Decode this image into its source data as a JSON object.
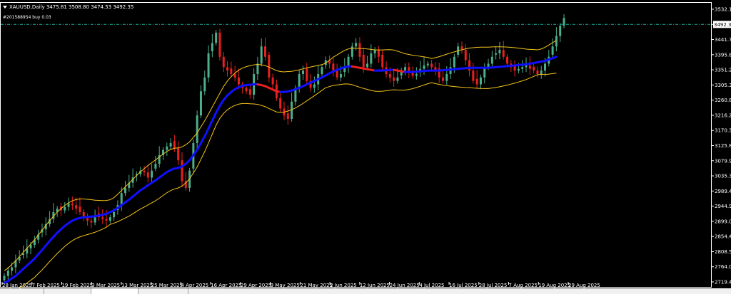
{
  "window": {
    "header": "XAUUSD,Daily  3475.81 3508.80 3474.53 3492.35",
    "order_label": "#201588954 buy 0.03"
  },
  "colors": {
    "background": "#000000",
    "frame": "#ffffff",
    "bull_candle": "#4caf8a",
    "bear_candle": "#e8201e",
    "fast_ma": "#1010ff",
    "ma_down_segment": "#e8201e",
    "envelope": "#f5c518",
    "order_line": "#1ab0a0",
    "price_box_bg": "#ffffff",
    "price_box_fg": "#000000"
  },
  "icons": {
    "menu_icon": "triangle-down-icon"
  },
  "chart_data": {
    "type": "candlestick",
    "symbol": "XAUUSD",
    "timeframe": "Daily",
    "last": {
      "open": 3475.81,
      "high": 3508.8,
      "low": 3474.53,
      "close": 3492.35
    },
    "current_price_label": "3492.35",
    "order_price": 3492.35,
    "y_ticks": [
      "3532.15",
      "3492.35",
      "3441.70",
      "3395.80",
      "3351.25",
      "3305.35",
      "3260.80",
      "3216.25",
      "3170.35",
      "3125.80",
      "3079.90",
      "3035.35",
      "2989.45",
      "2944.90",
      "2899.00",
      "2854.45",
      "2808.55",
      "2764.00",
      "2719.45"
    ],
    "ylim": [
      2719.45,
      3532.15
    ],
    "x_ticks": [
      "28 Jan 2025",
      "7 Feb 2025",
      "19 Feb 2025",
      "3 Mar 2025",
      "13 Mar 2025",
      "25 Mar 2025",
      "4 Apr 2025",
      "16 Apr 2025",
      "29 Apr 2025",
      "9 May 2025",
      "21 May 2025",
      "2 Jun 2025",
      "12 Jun 2025",
      "24 Jun 2025",
      "4 Jul 2025",
      "16 Jul 2025",
      "28 Jul 2025",
      "7 Aug 2025",
      "19 Aug 2025",
      "29 Aug 2025"
    ],
    "series_close": [
      2745,
      2760,
      2770,
      2790,
      2800,
      2810,
      2825,
      2835,
      2850,
      2865,
      2880,
      2895,
      2910,
      2930,
      2940,
      2935,
      2945,
      2955,
      2950,
      2940,
      2930,
      2915,
      2905,
      2900,
      2920,
      2915,
      2910,
      2905,
      2915,
      2930,
      2950,
      2985,
      3000,
      3015,
      3030,
      3040,
      3050,
      3045,
      3030,
      3050,
      3070,
      3095,
      3110,
      3120,
      3130,
      3115,
      3080,
      3020,
      3000,
      3050,
      3130,
      3210,
      3280,
      3320,
      3390,
      3420,
      3450,
      3380,
      3350,
      3340,
      3330,
      3320,
      3300,
      3290,
      3280,
      3270,
      3330,
      3360,
      3410,
      3380,
      3320,
      3300,
      3260,
      3230,
      3210,
      3200,
      3250,
      3290,
      3330,
      3340,
      3310,
      3290,
      3300,
      3330,
      3350,
      3370,
      3360,
      3340,
      3320,
      3330,
      3350,
      3380,
      3410,
      3420,
      3380,
      3350,
      3360,
      3390,
      3400,
      3380,
      3350,
      3330,
      3320,
      3310,
      3320,
      3340,
      3350,
      3335,
      3325,
      3330,
      3345,
      3355,
      3360,
      3350,
      3340,
      3320,
      3310,
      3330,
      3350,
      3380,
      3410,
      3400,
      3370,
      3340,
      3310,
      3300,
      3320,
      3350,
      3360,
      3380,
      3390,
      3400,
      3380,
      3360,
      3350,
      3340,
      3345,
      3350,
      3355,
      3345,
      3340,
      3330,
      3340,
      3360,
      3380,
      3410,
      3440,
      3470,
      3492.35
    ],
    "series_fast_ma": [
      2725,
      2730,
      2738,
      2745,
      2755,
      2765,
      2775,
      2785,
      2795,
      2808,
      2820,
      2833,
      2846,
      2858,
      2870,
      2880,
      2890,
      2898,
      2905,
      2910,
      2913,
      2915,
      2916,
      2917,
      2918,
      2920,
      2922,
      2925,
      2930,
      2935,
      2942,
      2950,
      2958,
      2966,
      2975,
      2984,
      2993,
      3000,
      3008,
      3015,
      3022,
      3030,
      3038,
      3046,
      3052,
      3056,
      3058,
      3062,
      3070,
      3080,
      3095,
      3110,
      3130,
      3150,
      3172,
      3195,
      3218,
      3238,
      3255,
      3268,
      3278,
      3286,
      3292,
      3296,
      3298,
      3299,
      3300,
      3300,
      3298,
      3295,
      3290,
      3285,
      3280,
      3278,
      3278,
      3280,
      3282,
      3286,
      3290,
      3295,
      3300,
      3305,
      3310,
      3315,
      3320,
      3326,
      3332,
      3338,
      3342,
      3346,
      3350,
      3352,
      3352,
      3350,
      3348,
      3346,
      3344,
      3342,
      3340,
      3340,
      3340,
      3341,
      3342,
      3342,
      3340,
      3338,
      3336,
      3336,
      3336,
      3337,
      3338,
      3339,
      3340,
      3340,
      3340,
      3340,
      3341,
      3342,
      3343,
      3344,
      3345,
      3346,
      3347,
      3348,
      3348,
      3348,
      3348,
      3348,
      3348,
      3349,
      3350,
      3351,
      3352,
      3353,
      3354,
      3355,
      3356,
      3357,
      3358,
      3360,
      3362,
      3364,
      3366,
      3368,
      3372,
      3376,
      3380
    ]
  },
  "tabs": [
    "",
    "",
    "",
    ""
  ]
}
